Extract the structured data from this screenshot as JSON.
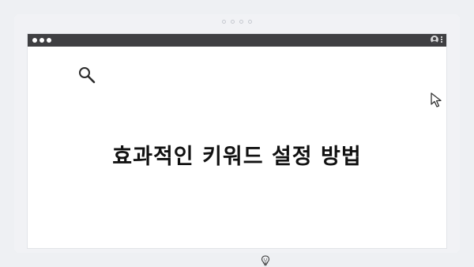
{
  "window": {
    "title_bar_color": "#3f3f42",
    "background": "#ffffff"
  },
  "icons": {
    "search": "search-icon",
    "cursor": "cursor-arrow-icon",
    "bulb": "lightbulb-icon",
    "user": "user-icon",
    "menu": "kebab-menu-icon"
  },
  "content": {
    "headline": "효과적인 키워드 설정 방법"
  }
}
